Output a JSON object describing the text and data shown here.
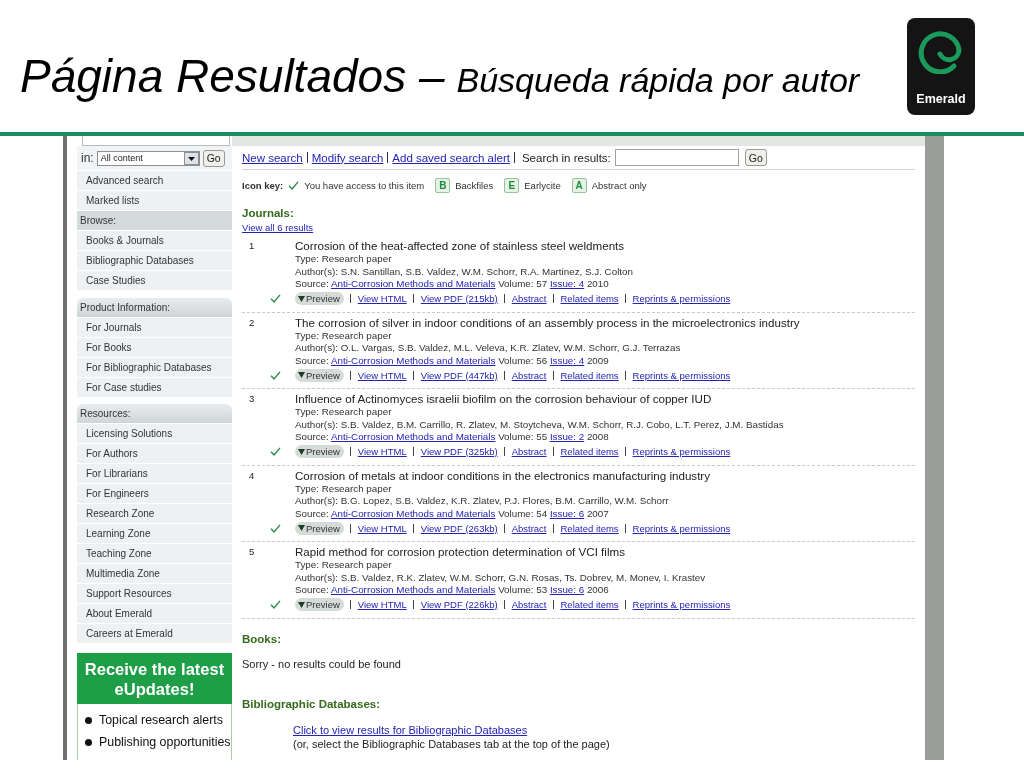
{
  "slide": {
    "title": "Página Resultados –",
    "subtitle": "Búsqueda rápida por autor",
    "logo_text": "Emerald"
  },
  "sidebar": {
    "search": {
      "scope_label": "in:",
      "scope": "All content",
      "go": "Go"
    },
    "groups": [
      {
        "kind": "links",
        "items": [
          "Advanced search",
          "Marked lists"
        ]
      },
      {
        "kind": "flat",
        "heading": "Browse:",
        "items": [
          "Books & Journals",
          "Bibliographic Databases",
          "Case Studies"
        ]
      },
      {
        "kind": "panel",
        "heading": "Product Information:",
        "items": [
          "For Journals",
          "For Books",
          "For Bibliographic Databases",
          "For Case studies"
        ]
      },
      {
        "kind": "panel",
        "heading": "Resources:",
        "items": [
          "Licensing Solutions",
          "For Authors",
          "For Librarians",
          "For Engineers",
          "Research Zone",
          "Learning Zone",
          "Teaching Zone",
          "Multimedia Zone",
          "Support Resources",
          "About Emerald",
          "Careers at Emerald"
        ]
      }
    ],
    "promo": {
      "title": "Receive the latest eUpdates!",
      "bullets": [
        "Topical research alerts",
        "Publishing opportunities"
      ]
    }
  },
  "toolbar": {
    "links": [
      "New search",
      "Modify search",
      "Add saved search alert"
    ],
    "search_label": "Search in results:",
    "go": "Go"
  },
  "icon_key": {
    "label": "Icon key:",
    "items": [
      {
        "kind": "check",
        "text": "You have access to this item"
      },
      {
        "kind": "badge",
        "letter": "B",
        "text": "Backfiles"
      },
      {
        "kind": "badge",
        "letter": "E",
        "text": "Earlycite"
      },
      {
        "kind": "badge",
        "letter": "A",
        "text": "Abstract only"
      }
    ]
  },
  "journals": {
    "heading": "Journals:",
    "view_all": "View all 6 results",
    "results": [
      {
        "number": "1",
        "title": "Corrosion of the heat-affected zone of stainless steel weldments",
        "type": "Type: Research paper",
        "authors": "Author(s): S.N. Santillan, S.B. Valdez, W.M. Schorr, R.A. Martinez, S.J. Colton",
        "source": {
          "label": "Source:",
          "journal": "Anti-Corrosion Methods and Materials",
          "volume": "Volume: 57",
          "issue": "Issue: 4",
          "year": "2010"
        },
        "access": true,
        "preview": "Preview",
        "links": [
          "View HTML",
          "View PDF (215kb)",
          "Abstract",
          "Related items",
          "Reprints & permissions"
        ]
      },
      {
        "number": "2",
        "title": "The corrosion of silver in indoor conditions of an assembly process in the microelectronics industry",
        "type": "Type: Research paper",
        "authors": "Author(s): O.L. Vargas, S.B. Valdez, M.L. Veleva, K.R. Zlatev, W.M. Schorr, G.J. Terrazas",
        "source": {
          "label": "Source:",
          "journal": "Anti-Corrosion Methods and Materials",
          "volume": "Volume: 56",
          "issue": "Issue: 4",
          "year": "2009"
        },
        "access": true,
        "preview": "Preview",
        "links": [
          "View HTML",
          "View PDF (447kb)",
          "Abstract",
          "Related items",
          "Reprints & permissions"
        ]
      },
      {
        "number": "3",
        "title": "Influence of Actinomyces israelii biofilm on the corrosion behaviour of copper IUD",
        "type": "Type: Research paper",
        "authors": "Author(s): S.B. Valdez, B.M. Carrillo, R. Zlatev, M. Stoytcheva, W.M. Schorr, R.J. Cobo, L.T. Perez, J.M. Bastidas",
        "source": {
          "label": "Source:",
          "journal": "Anti-Corrosion Methods and Materials",
          "volume": "Volume: 55",
          "issue": "Issue: 2",
          "year": "2008"
        },
        "access": true,
        "preview": "Preview",
        "links": [
          "View HTML",
          "View PDF (325kb)",
          "Abstract",
          "Related items",
          "Reprints & permissions"
        ]
      },
      {
        "number": "4",
        "title": "Corrosion of metals at indoor conditions in the electronics manufacturing industry",
        "type": "Type: Research paper",
        "authors": "Author(s): B.G. Lopez, S.B. Valdez, K.R. Zlatev, P.J. Flores, B.M. Carrillo, W.M. Schorr",
        "source": {
          "label": "Source:",
          "journal": "Anti-Corrosion Methods and Materials",
          "volume": "Volume: 54",
          "issue": "Issue: 6",
          "year": "2007"
        },
        "access": true,
        "preview": "Preview",
        "links": [
          "View HTML",
          "View PDF (263kb)",
          "Abstract",
          "Related items",
          "Reprints & permissions"
        ]
      },
      {
        "number": "5",
        "title": "Rapid method for corrosion protection determination of VCI films",
        "type": "Type: Research paper",
        "authors": "Author(s): S.B. Valdez, R.K. Zlatev, W.M. Schorr, G.N. Rosas, Ts. Dobrev, M. Monev, I. Krastev",
        "source": {
          "label": "Source:",
          "journal": "Anti-Corrosion Methods and Materials",
          "volume": "Volume: 53",
          "issue": "Issue: 6",
          "year": "2006"
        },
        "access": true,
        "preview": "Preview",
        "links": [
          "View HTML",
          "View PDF (226kb)",
          "Abstract",
          "Related items",
          "Reprints & permissions"
        ]
      }
    ]
  },
  "books": {
    "heading": "Books:",
    "message": "Sorry - no results could be found"
  },
  "databases": {
    "heading": "Bibliographic Databases:",
    "link": "Click to view results for Bibliographic Databases",
    "note": "(or, select the Bibliographic Databases tab at the top of the page)"
  }
}
